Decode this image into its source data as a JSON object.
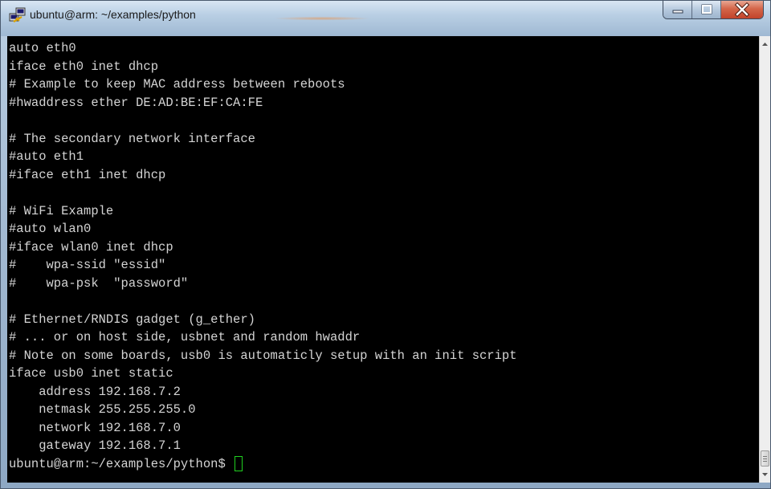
{
  "window": {
    "title": "ubuntu@arm: ~/examples/python",
    "app_icon": "putty-icon",
    "controls": {
      "minimize": "minimize-icon",
      "maximize": "maximize-icon",
      "close": "close-icon"
    }
  },
  "terminal": {
    "lines": [
      "auto eth0",
      "iface eth0 inet dhcp",
      "# Example to keep MAC address between reboots",
      "#hwaddress ether DE:AD:BE:EF:CA:FE",
      "",
      "# The secondary network interface",
      "#auto eth1",
      "#iface eth1 inet dhcp",
      "",
      "# WiFi Example",
      "#auto wlan0",
      "#iface wlan0 inet dhcp",
      "#    wpa-ssid \"essid\"",
      "#    wpa-psk  \"password\"",
      "",
      "# Ethernet/RNDIS gadget (g_ether)",
      "# ... or on host side, usbnet and random hwaddr",
      "# Note on some boards, usb0 is automaticly setup with an init script",
      "iface usb0 inet static",
      "    address 192.168.7.2",
      "    netmask 255.255.255.0",
      "    network 192.168.7.0",
      "    gateway 192.168.7.1"
    ],
    "prompt": "ubuntu@arm:~/examples/python$ ",
    "colors": {
      "background": "#000000",
      "foreground": "#d4d4d4",
      "cursor": "#20d020"
    }
  }
}
